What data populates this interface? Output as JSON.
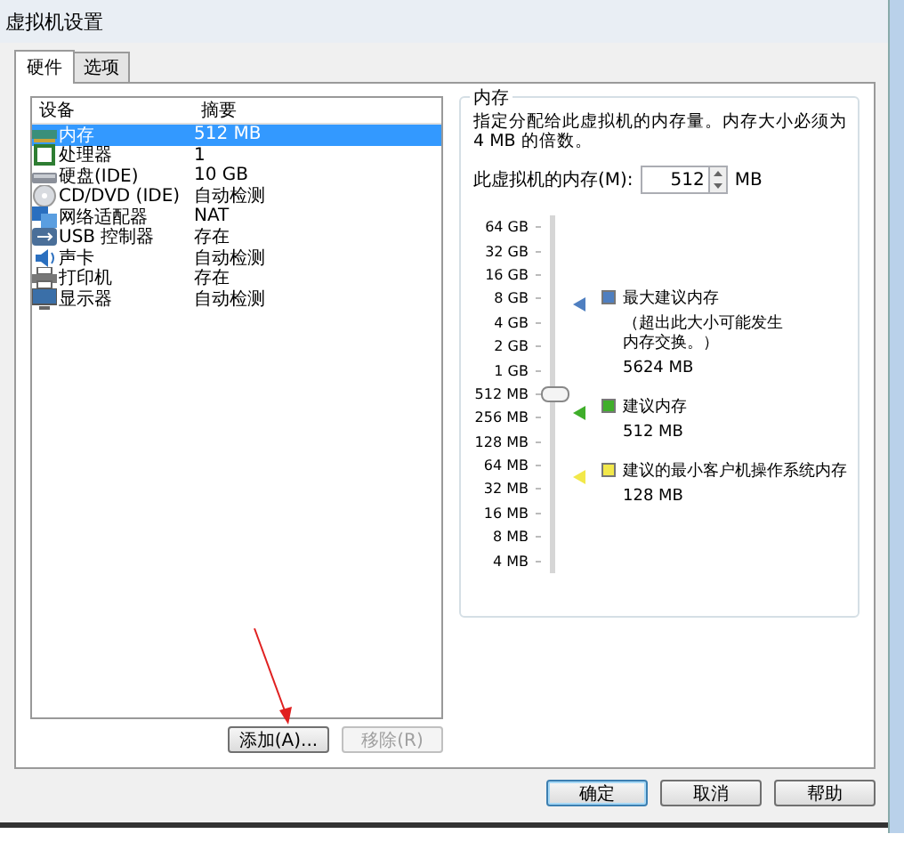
{
  "window": {
    "title": "虚拟机设置"
  },
  "tabs": [
    {
      "label": "硬件",
      "selected": true
    },
    {
      "label": "选项",
      "selected": false
    }
  ],
  "devices": {
    "columns": [
      "设备",
      "摘要"
    ],
    "rows": [
      {
        "kind": "memory",
        "name": "内存",
        "summary": "512 MB",
        "selected": true
      },
      {
        "kind": "cpu",
        "name": "处理器",
        "summary": "1",
        "selected": false
      },
      {
        "kind": "disk",
        "name": "硬盘(IDE)",
        "summary": "10 GB",
        "selected": false
      },
      {
        "kind": "cdrom",
        "name": "CD/DVD (IDE)",
        "summary": "自动检测",
        "selected": false
      },
      {
        "kind": "network",
        "name": "网络适配器",
        "summary": "NAT",
        "selected": false
      },
      {
        "kind": "usb",
        "name": "USB 控制器",
        "summary": "存在",
        "selected": false
      },
      {
        "kind": "sound",
        "name": "声卡",
        "summary": "自动检测",
        "selected": false
      },
      {
        "kind": "printer",
        "name": "打印机",
        "summary": "存在",
        "selected": false
      },
      {
        "kind": "display",
        "name": "显示器",
        "summary": "自动检测",
        "selected": false
      }
    ]
  },
  "device_buttons": [
    {
      "label": "添加(A)...",
      "disabled": false
    },
    {
      "label": "移除(R)",
      "disabled": true
    }
  ],
  "memory": {
    "title": "内存",
    "description": "指定分配给此虚拟机的内存量。内存大小必须为 4 MB 的倍数。",
    "field_label": "此虚拟机的内存(M):",
    "value": "512",
    "unit": "MB",
    "scale": [
      "64 GB",
      "32 GB",
      "16 GB",
      "8 GB",
      "4 GB",
      "2 GB",
      "1 GB",
      "512 MB",
      "256 MB",
      "128 MB",
      "64 MB",
      "32 MB",
      "16 MB",
      "8 MB",
      "4 MB"
    ],
    "slider": {
      "level": 0.5
    },
    "legend": [
      {
        "color": "#4f7fc0",
        "title": "最大建议内存",
        "note": "（超出此大小可能发生内存交换。）",
        "value": "5624 MB"
      },
      {
        "color": "#3fae2a",
        "title": "建议内存",
        "value": "512 MB"
      },
      {
        "color": "#f2e84a",
        "title": "建议的最小客户机操作系统内存",
        "value": "128 MB"
      }
    ]
  },
  "dialog_buttons": [
    {
      "label": "确定",
      "default": true
    },
    {
      "label": "取消",
      "default": false
    },
    {
      "label": "帮助",
      "default": false
    }
  ]
}
